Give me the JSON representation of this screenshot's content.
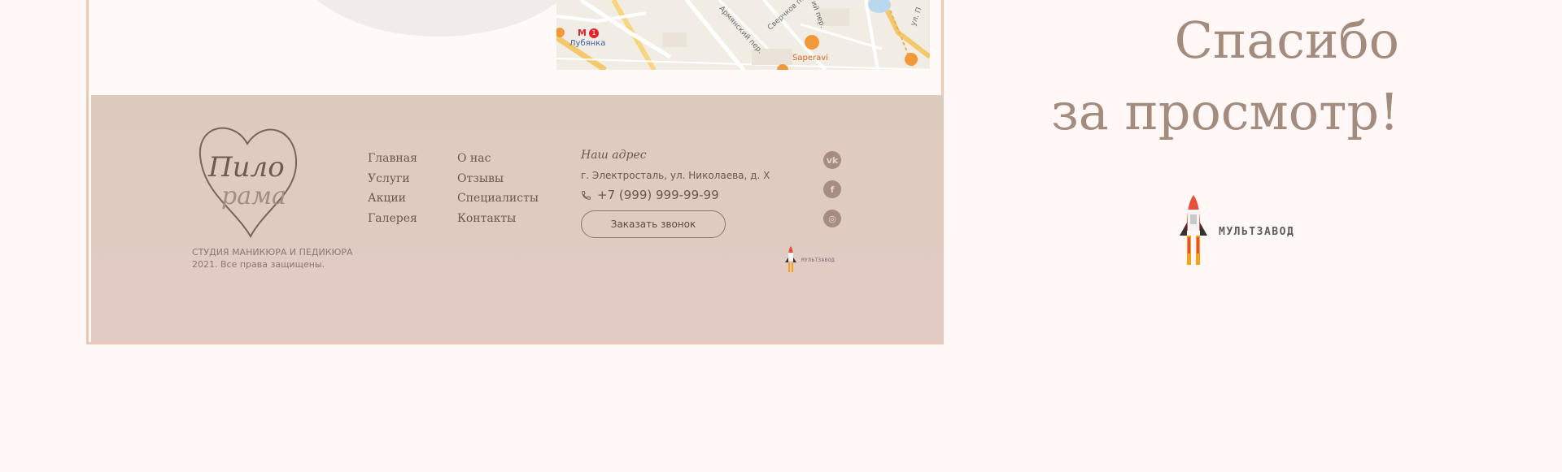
{
  "map": {
    "labels": {
      "metro": "Лубянка",
      "street1": "Армянский пер.",
      "street2": "Сверчков пер.",
      "street3": "ул. П",
      "street4": "ий пер.",
      "place": "Saperavi"
    },
    "metro_badge": "М",
    "metro_line": "1"
  },
  "footer": {
    "studio_name": "СТУДИЯ МАНИКЮРА И ПЕДИКЮРА",
    "copyright": "2021. Все права защищены.",
    "nav_col1": [
      "Главная",
      "Услуги",
      "Акции",
      "Галерея"
    ],
    "nav_col2": [
      "О нас",
      "Отзывы",
      "Специалисты",
      "Контакты"
    ],
    "address_title": "Наш адрес",
    "address": "г. Электросталь, ул. Николаева, д. Х",
    "phone": "+7 (999) 999-99-99",
    "callback_button": "Заказать звонок",
    "social": [
      {
        "name": "vk-icon",
        "glyph": "vk"
      },
      {
        "name": "facebook-icon",
        "glyph": "f"
      },
      {
        "name": "instagram-icon",
        "glyph": "◎"
      }
    ],
    "developer_small": "МУЛЬТЗАВОД"
  },
  "thanks": {
    "line1": "Спасибо",
    "line2": "за просмотр!"
  },
  "developer_big": "МУЛЬТЗАВОД",
  "colors": {
    "footer_bg": "#decbbf",
    "accent": "#a38c7e",
    "text": "#6b5851",
    "border": "#ecc8b6"
  }
}
